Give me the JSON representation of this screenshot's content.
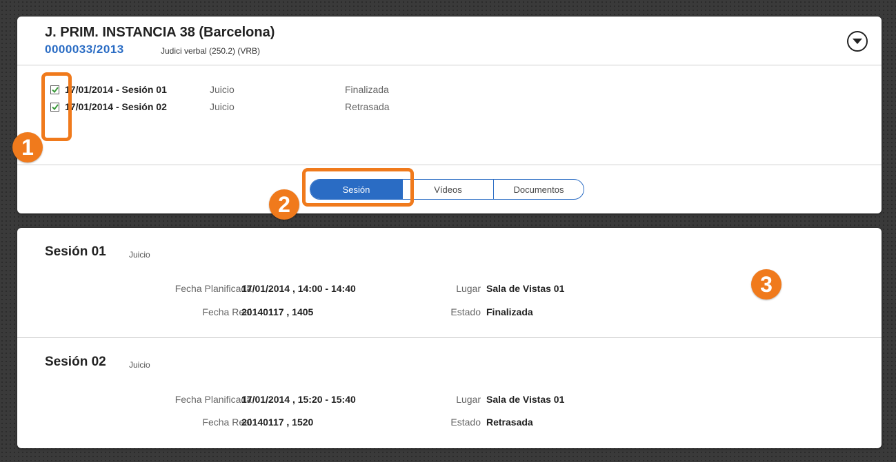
{
  "case": {
    "court": "J. PRIM. INSTANCIA 38 (Barcelona)",
    "number": "0000033/2013",
    "type": "Judici verbal (250.2) (VRB)"
  },
  "sessions_list": [
    {
      "date_label": "17/01/2014 - Sesión 01",
      "kind": "Juicio",
      "state": "Finalizada",
      "checked": true
    },
    {
      "date_label": "17/01/2014 - Sesión 02",
      "kind": "Juicio",
      "state": "Retrasada",
      "checked": true
    }
  ],
  "tabs": [
    "Sesión",
    "Vídeos",
    "Documentos"
  ],
  "active_tab": "Sesión",
  "callouts": [
    "1",
    "2",
    "3"
  ],
  "details": [
    {
      "title": "Sesión 01",
      "kind": "Juicio",
      "planned_label": "Fecha Planificada",
      "planned": "17/01/2014 , 14:00 - 14:40",
      "real_label": "Fecha Real",
      "real": "20140117 , 1405",
      "place_label": "Lugar",
      "place": "Sala de Vistas 01",
      "state_label": "Estado",
      "state": "Finalizada"
    },
    {
      "title": "Sesión 02",
      "kind": "Juicio",
      "planned_label": "Fecha Planificada",
      "planned": "17/01/2014 , 15:20 - 15:40",
      "real_label": "Fecha Real",
      "real": "20140117 , 1520",
      "place_label": "Lugar",
      "place": "Sala de Vistas 01",
      "state_label": "Estado",
      "state": "Retrasada"
    }
  ],
  "colors": {
    "accent": "#2a6cc4",
    "callout": "#f07a1c"
  },
  "icons": {
    "expand": "chevron-down-circle-icon",
    "check": "checkmark-icon"
  }
}
